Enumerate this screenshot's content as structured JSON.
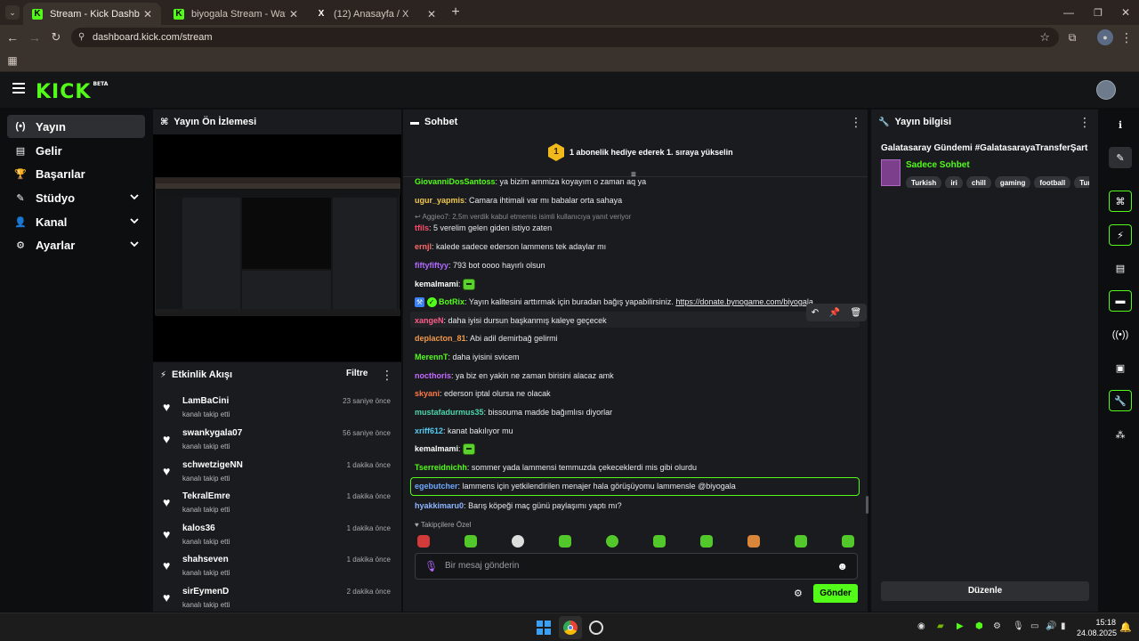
{
  "browser": {
    "tabs": [
      {
        "title": "Stream - Kick Dashboard",
        "favicon": "K",
        "active": true
      },
      {
        "title": "biyogala Stream - Watch Live o",
        "favicon": "K",
        "active": false
      },
      {
        "title": "(12) Anasayfa / X",
        "favicon": "X",
        "active": false
      }
    ],
    "url": "dashboard.kick.com/stream"
  },
  "app": {
    "logo": "KICK",
    "logo_badge": "BETA",
    "brand_color": "#53fc18"
  },
  "sidebar": {
    "items": [
      {
        "label": "Yayın",
        "icon": "broadcast-icon",
        "glyph": "(•)",
        "active": true,
        "expandable": false
      },
      {
        "label": "Gelir",
        "icon": "revenue-icon",
        "glyph": "▤",
        "active": false,
        "expandable": false
      },
      {
        "label": "Başarılar",
        "icon": "trophy-icon",
        "glyph": "🏆",
        "active": false,
        "expandable": false
      },
      {
        "label": "Stüdyo",
        "icon": "studio-icon",
        "glyph": "✎",
        "active": false,
        "expandable": true
      },
      {
        "label": "Kanal",
        "icon": "channel-icon",
        "glyph": "👤",
        "active": false,
        "expandable": true
      },
      {
        "label": "Ayarlar",
        "icon": "settings-icon",
        "glyph": "⚙",
        "active": false,
        "expandable": true
      }
    ]
  },
  "preview": {
    "title": "Yayın Ön İzlemesi"
  },
  "activity": {
    "title": "Etkinlik Akışı",
    "filter_label": "Filtre",
    "events": [
      {
        "user": "LamBaCini",
        "action": "kanalı takip etti",
        "time": "23 saniye önce"
      },
      {
        "user": "swankygala07",
        "action": "kanalı takip etti",
        "time": "56 saniye önce"
      },
      {
        "user": "schwetzigeNN",
        "action": "kanalı takip etti",
        "time": "1 dakika önce"
      },
      {
        "user": "TekralEmre",
        "action": "kanalı takip etti",
        "time": "1 dakika önce"
      },
      {
        "user": "kalos36",
        "action": "kanalı takip etti",
        "time": "1 dakika önce"
      },
      {
        "user": "shahseven",
        "action": "kanalı takip etti",
        "time": "1 dakika önce"
      },
      {
        "user": "sirEymenD",
        "action": "kanalı takip etti",
        "time": "2 dakika önce"
      }
    ]
  },
  "chat": {
    "title": "Sohbet",
    "gift_badge": "1",
    "gift_banner": "1 abonelik hediye ederek 1. sıraya yükselin",
    "messages": [
      {
        "user": "GiovanniDosSantoss",
        "color": "#53fc18",
        "text": "ya bizim ammiza koyayım o zaman aq ya"
      },
      {
        "user": "ugur_yapmis",
        "color": "#f2c94c",
        "text": "Camara ihtimali var mı babalar orta sahaya"
      },
      {
        "user": "tfils",
        "color": "#ff4d6d",
        "text": "5 verelim gelen giden istiyo zaten",
        "reply": "Aggieo7: 2,5m verdik kabul etmemis isimli kullanıcıya yanıt veriyor"
      },
      {
        "user": "ernjl",
        "color": "#ff6b6b",
        "text": "kalede sadece ederson lammens tek adaylar mı"
      },
      {
        "user": "fiftyfiftyy",
        "color": "#b36bff",
        "text": "793 bot oooo hayırlı olsun"
      },
      {
        "user": "kemalmami",
        "color": "#ffffff",
        "text": "",
        "emote": true
      },
      {
        "user": "BotRix",
        "color": "#53fc18",
        "text": "Yayın kalitesini arttırmak için buradan bağış yapabilirsiniz. ",
        "link": "https://donate.bynogame.com/biyogala",
        "bot": true
      },
      {
        "user": "xangeN",
        "color": "#ff5c8a",
        "text": "daha iyisi dursun başkanmış kaleye geçecek",
        "hover": true
      },
      {
        "user": "deplacton_81",
        "color": "#f2994a",
        "text": "Abi adil demirbağ gelirmi"
      },
      {
        "user": "MerennT",
        "color": "#53fc18",
        "text": "daha iyisini svicem"
      },
      {
        "user": "nocthoris",
        "color": "#c56bff",
        "text": "ya biz en yakin ne zaman birisini alacaz amk"
      },
      {
        "user": "skyani",
        "color": "#ff7a45",
        "text": "ederson iptal olursa ne olacak"
      },
      {
        "user": "mustafadurmus35",
        "color": "#4dd4ac",
        "text": "bissouma madde bağımlısı diyorlar"
      },
      {
        "user": "xriff612",
        "color": "#56ccf2",
        "text": "kanat bakılıyor mu"
      },
      {
        "user": "kemalmami",
        "color": "#ffffff",
        "text": "",
        "emote": true
      },
      {
        "user": "Tserreidnichh",
        "color": "#53fc18",
        "text": "sommer yada lammensi temmuzda çekeceklerdi mis gibi olurdu"
      },
      {
        "user": "egebutcher",
        "color": "#6fa8ff",
        "text": "lammens için yetkilendirilen menajer hala görüşüyomu lammensle @biyogala",
        "highlight": true
      },
      {
        "user": "hyakkimaru0",
        "color": "#8fb6ff",
        "text": "Barış köpeği maç günü paylaşımı yaptı mı?"
      }
    ],
    "quick_emotes_label": "Takipçilere Özel",
    "input_placeholder": "Bir mesaj gönderin",
    "send_label": "Gönder"
  },
  "stream_info": {
    "title": "Yayın bilgisi",
    "stream_title": "Galatasaray Gündemi #GalatasarayaTransferŞart",
    "category": "Sadece Sohbet",
    "tags": [
      "Turkish",
      "iri",
      "chill",
      "gaming",
      "football",
      "Tur"
    ],
    "edit_label": "Düzenle"
  },
  "taskbar": {
    "time": "15:18",
    "date": "24.08.2025"
  }
}
